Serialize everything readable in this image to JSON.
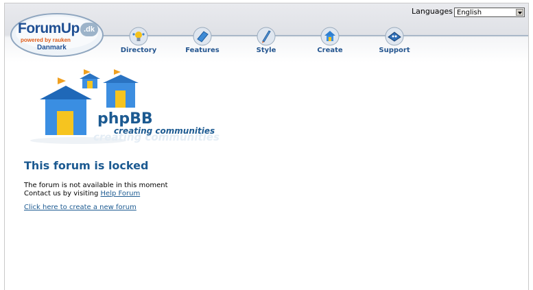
{
  "header": {
    "logo": {
      "brand": "ForumUp",
      "badge": ".dk",
      "tagline": "powered by rauken",
      "region": "Danmark"
    },
    "nav": [
      {
        "label": "Directory",
        "icon": "lightbulb-icon"
      },
      {
        "label": "Features",
        "icon": "book-icon"
      },
      {
        "label": "Style",
        "icon": "pen-icon"
      },
      {
        "label": "Create",
        "icon": "house-icon"
      },
      {
        "label": "Support",
        "icon": "puzzle-icon"
      }
    ],
    "languages": {
      "label": "Languages",
      "selected": "English"
    }
  },
  "phpbb_logo": {
    "name": "phpBB",
    "tagline": "creating communities"
  },
  "content": {
    "title": "This forum is locked",
    "line1": "The forum is not available in this moment",
    "line2_prefix": "Contact us by visiting ",
    "line2_link": "Help Forum",
    "create_link": "Click here to create a new forum"
  },
  "colors": {
    "link": "#1c5a91",
    "nav_label": "#24558f",
    "brand_blue": "#1f4f93",
    "accent_orange": "#e05c18"
  }
}
